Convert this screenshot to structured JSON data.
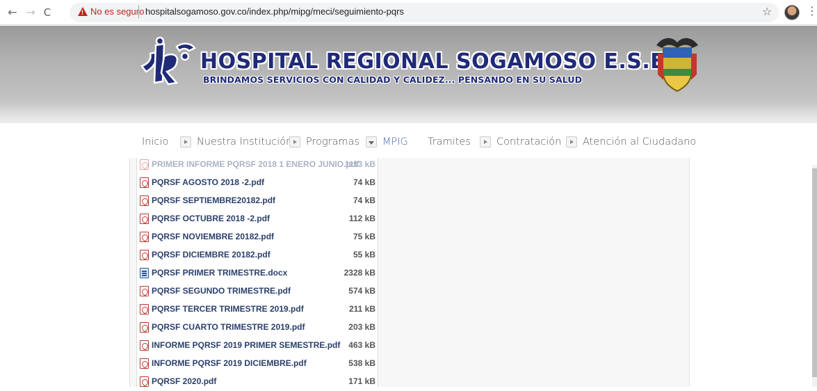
{
  "browser": {
    "back_glyph": "←",
    "forward_glyph": "→",
    "reload_glyph": "C",
    "security_label": "No es seguro",
    "url": "hospitalsogamoso.gov.co/index.php/mipg/meci/seguimiento-pqrs",
    "star_glyph": "☆",
    "menu_glyph": "⋮"
  },
  "header": {
    "title": "HOSPITAL REGIONAL SOGAMOSO E.S.E",
    "tagline": "BRINDAMOS SERVICIOS CON CALIDAD Y CALIDEZ... PENSANDO EN SU SALUD",
    "logo_icon": "hrs-logo-icon",
    "crest_icon": "colombia-coat-of-arms-icon"
  },
  "menu": {
    "items": [
      {
        "label": "Inicio"
      },
      {
        "label": "Nuestra Institución"
      },
      {
        "label": "Programas"
      },
      {
        "label": "MPIG"
      },
      {
        "label": "Tramites"
      },
      {
        "label": "Contratación"
      },
      {
        "label": "Atención al Ciudadano"
      }
    ]
  },
  "files": [
    {
      "name": "PRIMER INFORME PQRSF 2018 1 ENERO JUNIO.pdf",
      "size": "1113 kB",
      "type": "pdf"
    },
    {
      "name": "PQRSF AGOSTO 2018 -2.pdf",
      "size": "74 kB",
      "type": "pdf"
    },
    {
      "name": "PQRSF SEPTIEMBRE20182.pdf",
      "size": "74 kB",
      "type": "pdf"
    },
    {
      "name": "PQRSF OCTUBRE 2018 -2.pdf",
      "size": "112 kB",
      "type": "pdf"
    },
    {
      "name": "PQRSF NOVIEMBRE 20182.pdf",
      "size": "75 kB",
      "type": "pdf"
    },
    {
      "name": "PQRSF DICIEMBRE 20182.pdf",
      "size": "55 kB",
      "type": "pdf"
    },
    {
      "name": "PQRSF PRIMER TRIMESTRE.docx",
      "size": "2328 kB",
      "type": "docx"
    },
    {
      "name": "PQRSF SEGUNDO TRIMESTRE.pdf",
      "size": "574 kB",
      "type": "pdf"
    },
    {
      "name": "PQRSF TERCER TRIMESTRE 2019.pdf",
      "size": "211 kB",
      "type": "pdf"
    },
    {
      "name": "PQRSF CUARTO TRIMESTRE 2019.pdf",
      "size": "203 kB",
      "type": "pdf"
    },
    {
      "name": "INFORME PQRSF 2019 PRIMER SEMESTRE.pdf",
      "size": "463 kB",
      "type": "pdf"
    },
    {
      "name": "INFORME PQRSF 2019 DICIEMBRE.pdf",
      "size": "538 kB",
      "type": "pdf"
    },
    {
      "name": "PQRSF 2020.pdf",
      "size": "171 kB",
      "type": "pdf"
    }
  ]
}
